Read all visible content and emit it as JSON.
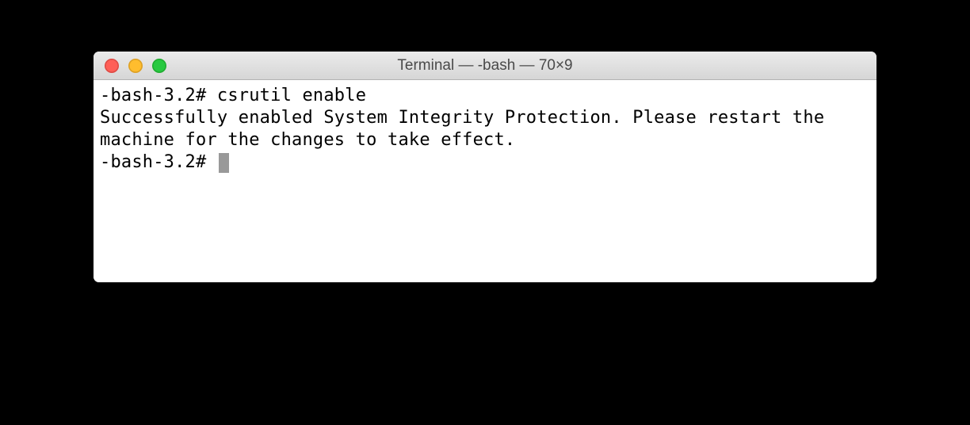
{
  "window": {
    "title": "Terminal — -bash — 70×9"
  },
  "terminal": {
    "line1_prompt": "-bash-3.2# ",
    "line1_command": "csrutil enable",
    "output": "Successfully enabled System Integrity Protection. Please restart the machine for the changes to take effect.",
    "line3_prompt": "-bash-3.2# "
  }
}
